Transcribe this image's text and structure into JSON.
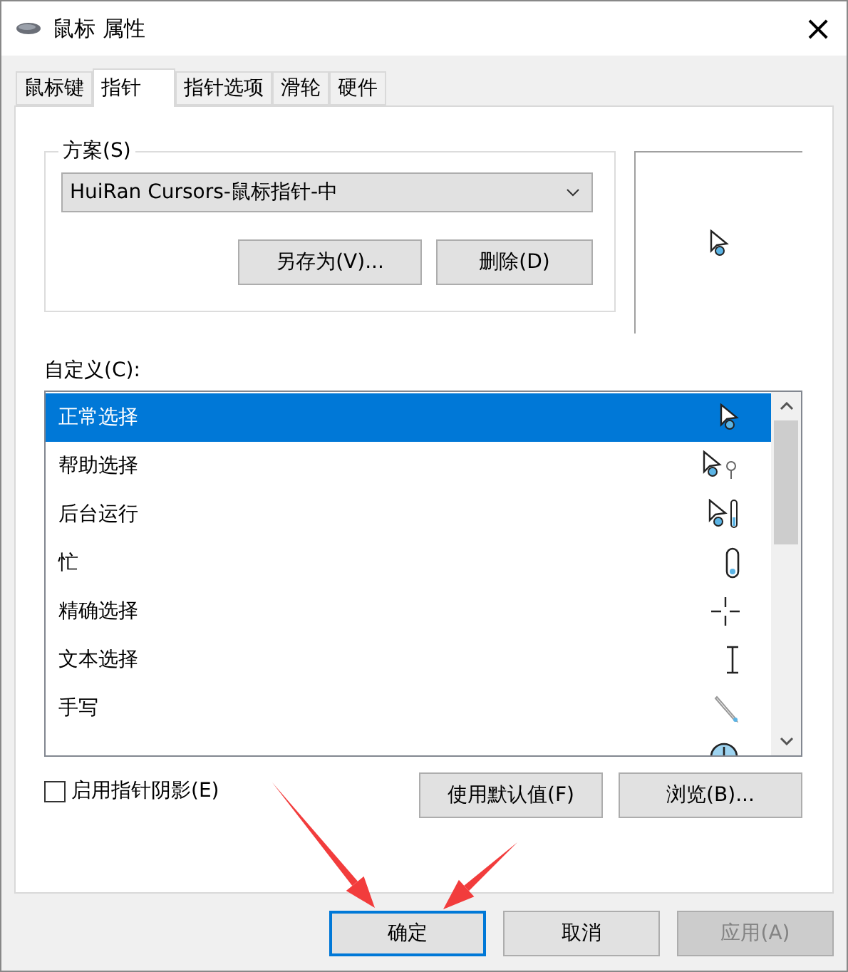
{
  "window": {
    "title": "鼠标 属性",
    "close": "×"
  },
  "tabs": [
    {
      "label": "鼠标键",
      "selected": false
    },
    {
      "label": "指针",
      "selected": true
    },
    {
      "label": "指针选项",
      "selected": false
    },
    {
      "label": "滑轮",
      "selected": false
    },
    {
      "label": "硬件",
      "selected": false
    }
  ],
  "scheme": {
    "legend": "方案(S)",
    "value": "HuiRan Cursors-鼠标指针-中",
    "buttons": [
      "另存为(V)...",
      "删除(D)"
    ]
  },
  "customize_label": "自定义(C):",
  "cursors": [
    {
      "label": "正常选择",
      "kind": "normal",
      "selected": true
    },
    {
      "label": "帮助选择",
      "kind": "help",
      "selected": false
    },
    {
      "label": "后台运行",
      "kind": "working",
      "selected": false
    },
    {
      "label": "忙",
      "kind": "busy",
      "selected": false
    },
    {
      "label": "精确选择",
      "kind": "precision",
      "selected": false
    },
    {
      "label": "文本选择",
      "kind": "text",
      "selected": false
    },
    {
      "label": "手写",
      "kind": "pen",
      "selected": false
    },
    {
      "kind": "unavailable",
      "selected": false
    }
  ],
  "shadow": {
    "label": "启用指针阴影(E)",
    "checked": false
  },
  "list_buttons": [
    "使用默认值(F)",
    "浏览(B)..."
  ],
  "dialog_buttons": [
    {
      "label": "确定",
      "kind": "default",
      "disabled": false
    },
    {
      "label": "取消",
      "kind": "normal",
      "disabled": false
    },
    {
      "label": "应用(A)",
      "kind": "normal",
      "disabled": true
    }
  ],
  "annotations": [
    {
      "kind": "arrow"
    },
    {
      "kind": "arrow"
    }
  ]
}
